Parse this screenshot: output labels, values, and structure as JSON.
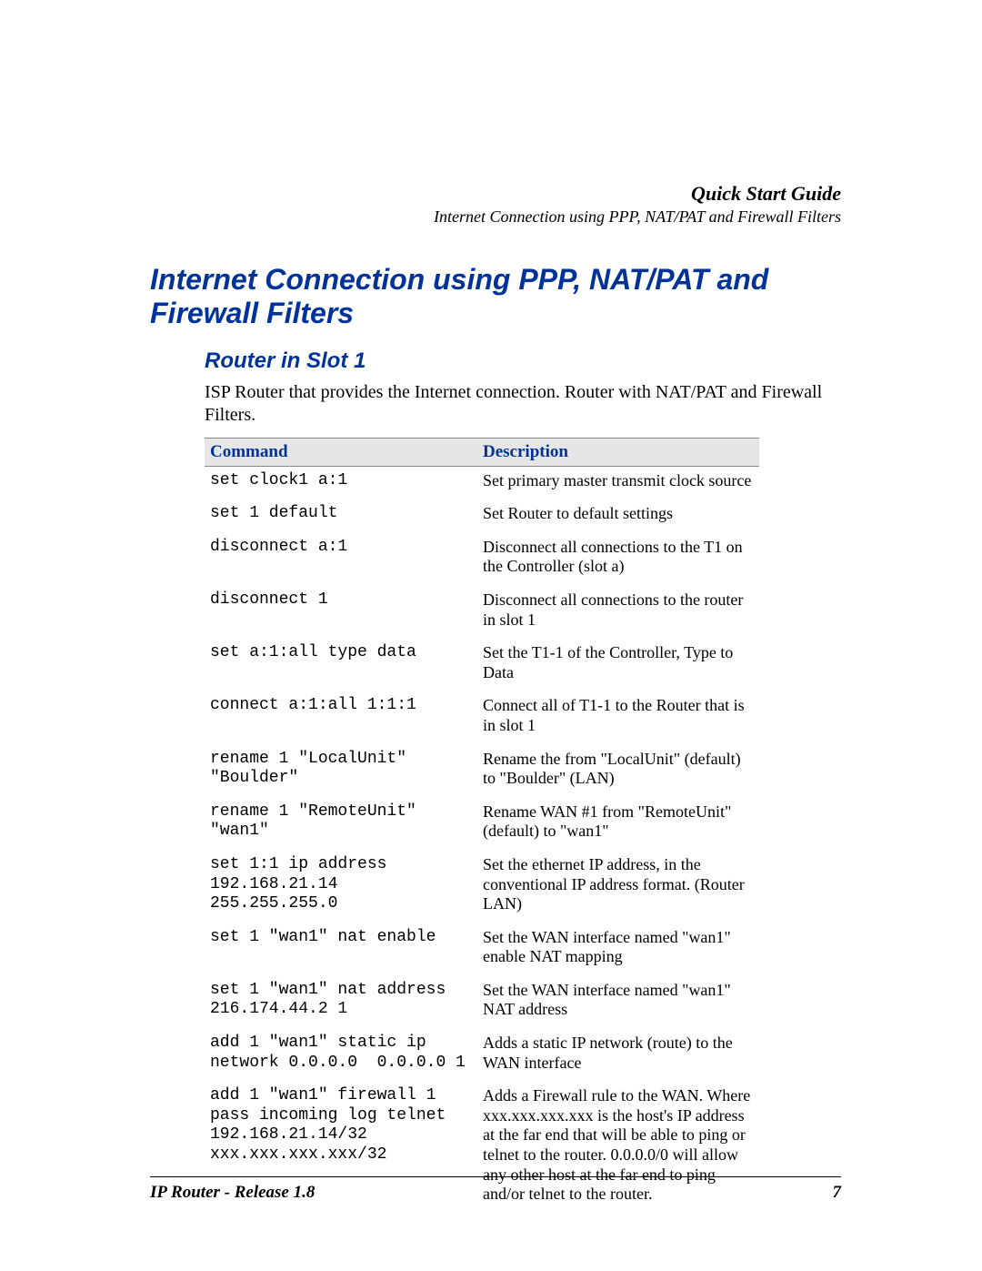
{
  "header": {
    "title": "Quick Start Guide",
    "subtitle": "Internet Connection using PPP, NAT/PAT and Firewall Filters"
  },
  "h1": "Internet Connection using PPP, NAT/PAT and Firewall Filters",
  "h2": "Router in Slot 1",
  "intro": "ISP Router that provides the Internet connection. Router with NAT/PAT and Firewall Filters.",
  "table": {
    "headers": {
      "command": "Command",
      "description": "Description"
    },
    "rows": [
      {
        "cmd": "set clock1 a:1",
        "desc": "Set primary master transmit clock source"
      },
      {
        "cmd": "set 1 default",
        "desc": "Set Router to default settings"
      },
      {
        "cmd": "disconnect a:1",
        "desc": "Disconnect all connections to the T1 on the Controller (slot a)"
      },
      {
        "cmd": "disconnect 1",
        "desc": "Disconnect all connections to the router in slot 1"
      },
      {
        "cmd": "set a:1:all type data",
        "desc": "Set the T1-1 of the Controller, Type to Data"
      },
      {
        "cmd": "connect a:1:all 1:1:1",
        "desc": "Connect all of T1-1 to the Router that is in slot 1"
      },
      {
        "cmd": "rename 1 \"LocalUnit\" \"Boulder\"",
        "desc": "Rename the from \"LocalUnit\" (default) to \"Boulder\" (LAN)"
      },
      {
        "cmd": "rename 1 \"RemoteUnit\" \"wan1\"",
        "desc": "Rename WAN #1 from \"RemoteUnit\" (default) to \"wan1\""
      },
      {
        "cmd": "set 1:1 ip address 192.168.21.14 255.255.255.0",
        "desc": "Set the ethernet IP address, in the conventional IP address format. (Router LAN)"
      },
      {
        "cmd": "set 1 \"wan1\" nat enable",
        "desc": "Set the WAN interface named \"wan1\" enable NAT mapping"
      },
      {
        "cmd": "set 1 \"wan1\" nat address 216.174.44.2 1",
        "desc": "Set the WAN interface named \"wan1\" NAT address"
      },
      {
        "cmd": "add 1 \"wan1\" static ip network 0.0.0.0  0.0.0.0 1",
        "desc": "Adds a static IP network (route) to the WAN interface"
      },
      {
        "cmd": "add 1 \"wan1\" firewall 1 pass incoming log telnet 192.168.21.14/32 xxx.xxx.xxx.xxx/32",
        "desc": "Adds a Firewall rule to the WAN. Where xxx.xxx.xxx.xxx is the host's IP address at the far end that will be able to ping or telnet to the router. 0.0.0.0/0 will allow any other host at the far end to ping and/or telnet to the router."
      }
    ]
  },
  "footer": {
    "left": "IP Router - Release 1.8",
    "right": "7"
  }
}
